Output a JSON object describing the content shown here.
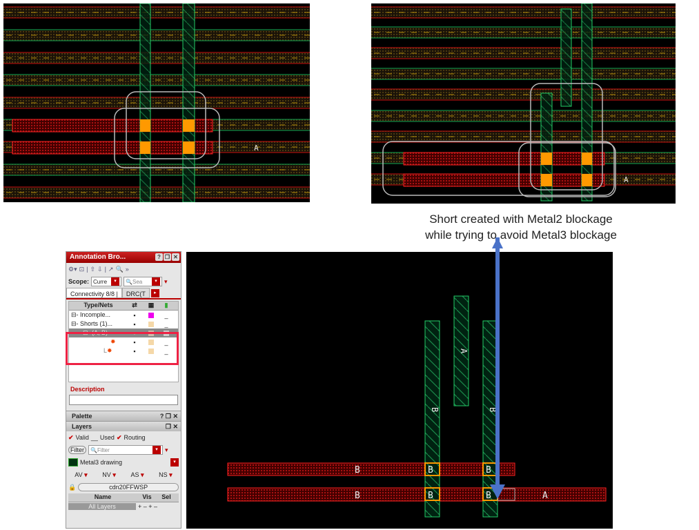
{
  "caption": {
    "line1": "Short created with Metal2 blockage",
    "line2": "while trying to avoid Metal3 blockage"
  },
  "colors": {
    "metal2": "#cc1111",
    "metal3": "#11aa55",
    "via": "#ff9900",
    "arrow": "#4a72c8",
    "highlight": "#e24"
  },
  "annotation_browser": {
    "title": "Annotation Bro...",
    "scope_label": "Scope:",
    "scope_value": "Curre",
    "search_placeholder": "Sea",
    "tabs": [
      "Connectivity 8/8 |",
      "DRC(T"
    ],
    "columns": {
      "name": "Type/Nets"
    },
    "rows": [
      {
        "label": "⊟- Incomple...",
        "vis": "▪",
        "color": "#ee00ee"
      },
      {
        "label": "⊟- Shorts (1)...",
        "vis": "▪",
        "color": "#f5d8a8"
      },
      {
        "label": "⊟- (A, B)",
        "vis": "▪",
        "color": "#ccbbaa"
      },
      {
        "label": "",
        "vis": "▪",
        "color": "#f5d8a8"
      },
      {
        "label": "L",
        "vis": "▪",
        "color": "#f5d8a8"
      }
    ],
    "description_label": "Description"
  },
  "palette": {
    "title": "Palette"
  },
  "layers": {
    "title": "Layers",
    "valid": "Valid",
    "used": "Used",
    "routing": "Routing",
    "filter_button": "Filter",
    "filter_placeholder": "Filter",
    "current_layer": "Metal3 drawing",
    "toggles": [
      "AV",
      "NV",
      "AS",
      "NS"
    ],
    "tech": "cdn20FFWSP",
    "col_name": "Name",
    "col_vis": "Vis",
    "col_sel": "Sel",
    "first_row": "All Layers"
  },
  "canvas_labels": {
    "a": "A",
    "b": "B"
  }
}
